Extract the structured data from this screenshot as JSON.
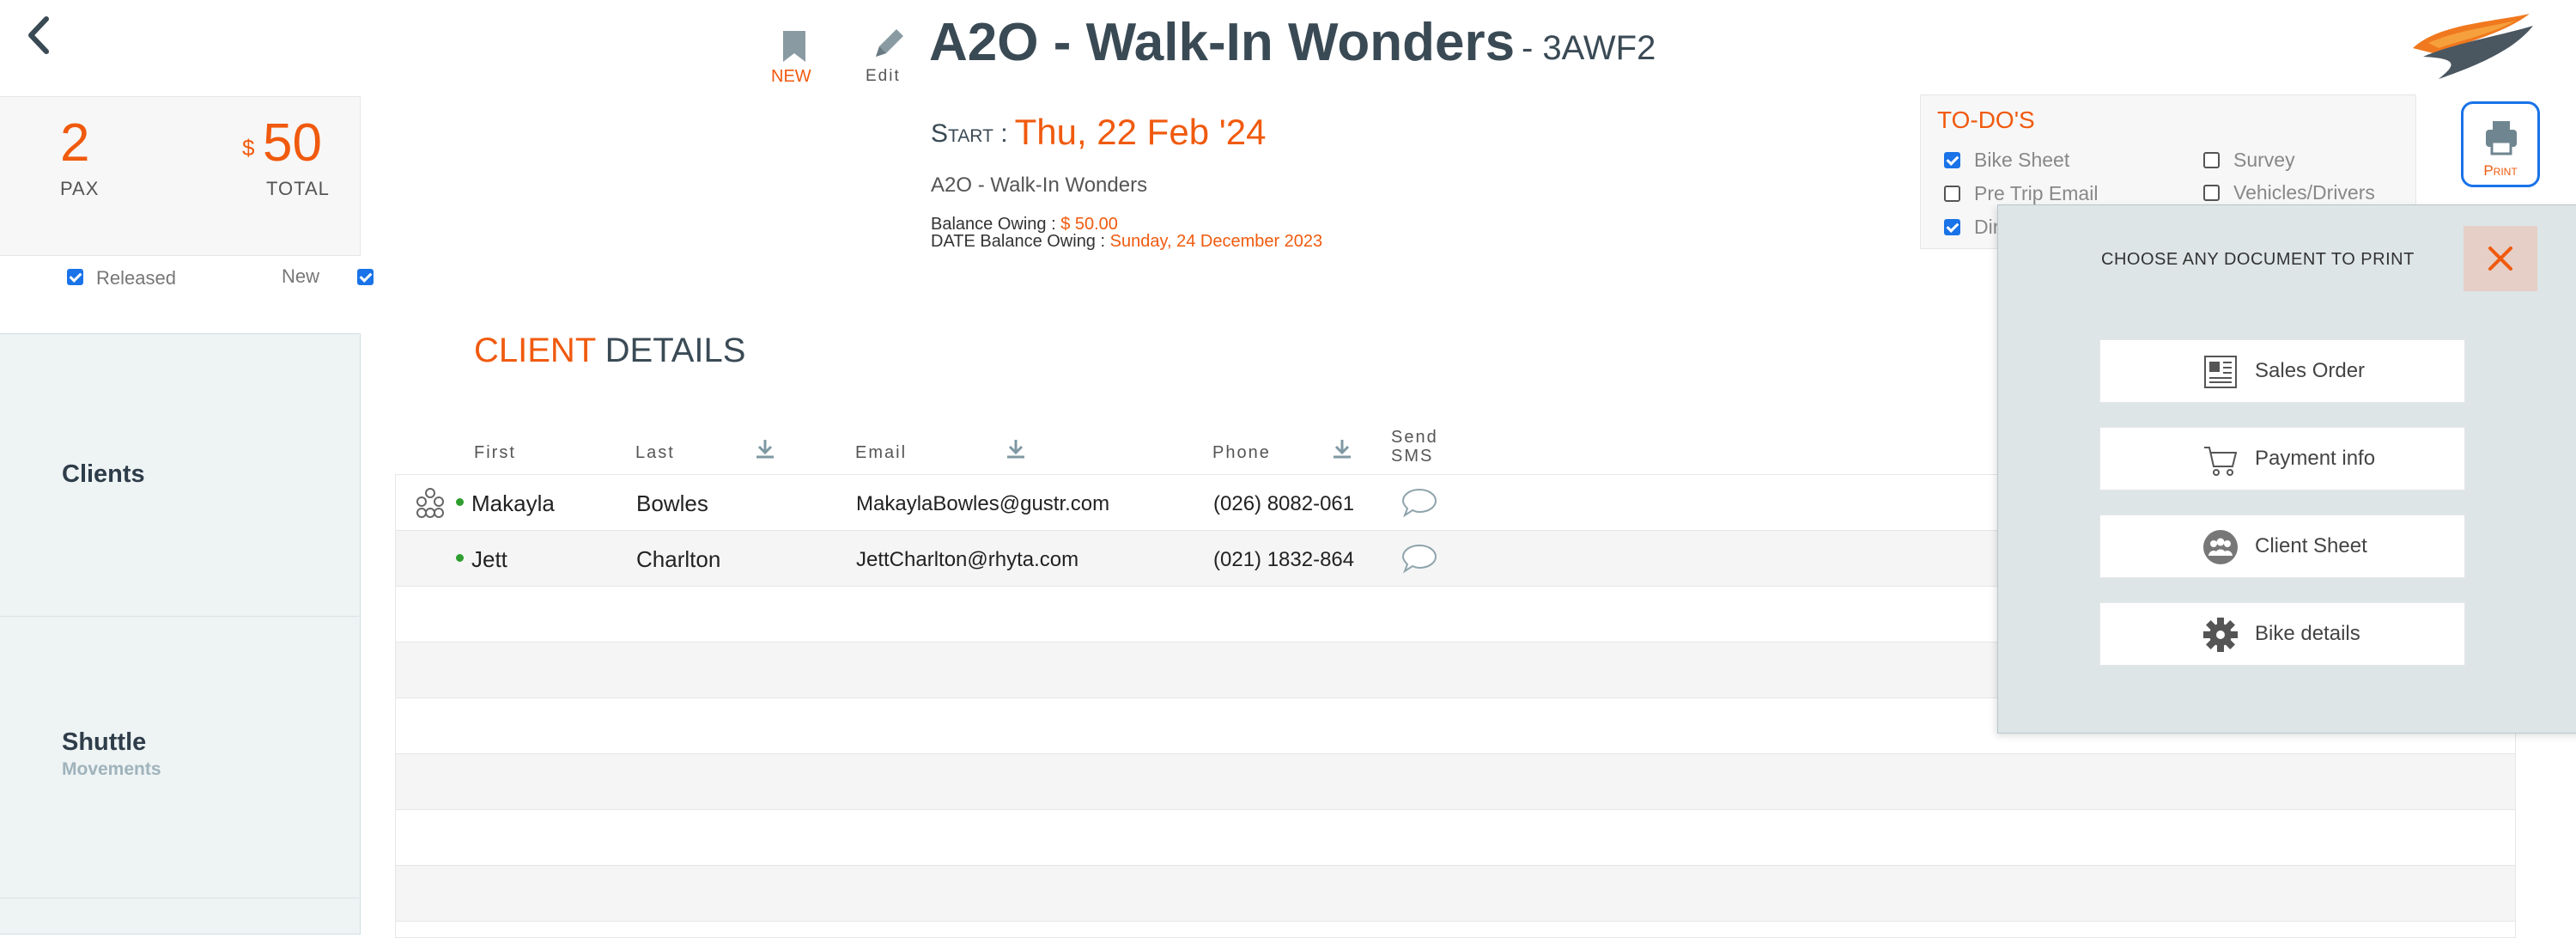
{
  "header": {
    "back_icon": "chevron-left-icon",
    "bookmark_label": "NEW",
    "edit_label": "Edit",
    "title": "A2O - Walk-In Wonders",
    "code": "- 3AWF2",
    "start_label": "Start :",
    "start_date": "Thu, 22 Feb '24",
    "subtitle": "A2O - Walk-In Wonders",
    "balance_label": "Balance Owing :",
    "balance_value": "$ 50.00",
    "balance_date_label": "DATE Balance Owing :",
    "balance_date_value": "Sunday, 24 December 2023"
  },
  "stats": {
    "pax_value": "2",
    "pax_label": "PAX",
    "currency": "$",
    "total_value": "50",
    "total_label": "TOTAL",
    "released_label": "Released",
    "new_label": "New"
  },
  "nav": {
    "clients": "Clients",
    "shuttle": "Shuttle",
    "movements": "Movements"
  },
  "todo": {
    "title": "TO-DO'S",
    "items": [
      {
        "label": "Bike Sheet",
        "checked": true
      },
      {
        "label": "Survey",
        "checked": false
      },
      {
        "label": "Pre Trip Email",
        "checked": false
      },
      {
        "label": "Vehicles/Drivers",
        "checked": false
      },
      {
        "label": "Dir",
        "checked": true
      }
    ]
  },
  "print": {
    "button_label": "Print",
    "panel_title": "CHOOSE ANY DOCUMENT TO PRINT",
    "documents": [
      {
        "label": "Sales Order",
        "icon": "document-icon"
      },
      {
        "label": "Payment info",
        "icon": "cart-icon"
      },
      {
        "label": "Client Sheet",
        "icon": "group-icon"
      },
      {
        "label": "Bike details",
        "icon": "gear-icon"
      }
    ]
  },
  "clients": {
    "section_title_accent": "CLIENT",
    "section_title_rest": "DETAILS",
    "columns": [
      "First",
      "Last",
      "Email",
      "Phone",
      "Send",
      "SMS"
    ],
    "rows": [
      {
        "first": "Makayla",
        "last": "Bowles",
        "email": "MakaylaBowles@gustr.com",
        "phone": "(026) 8082-061"
      },
      {
        "first": "Jett",
        "last": "Charlton",
        "email": "JettCharlton@rhyta.com",
        "phone": "(021) 1832-864"
      }
    ]
  },
  "colors": {
    "accent": "#f05a0e",
    "title": "#3a4a55",
    "checkbox": "#1a73e8",
    "status_dot": "#2e9e2e",
    "panel_bg": "#dde5e7"
  }
}
